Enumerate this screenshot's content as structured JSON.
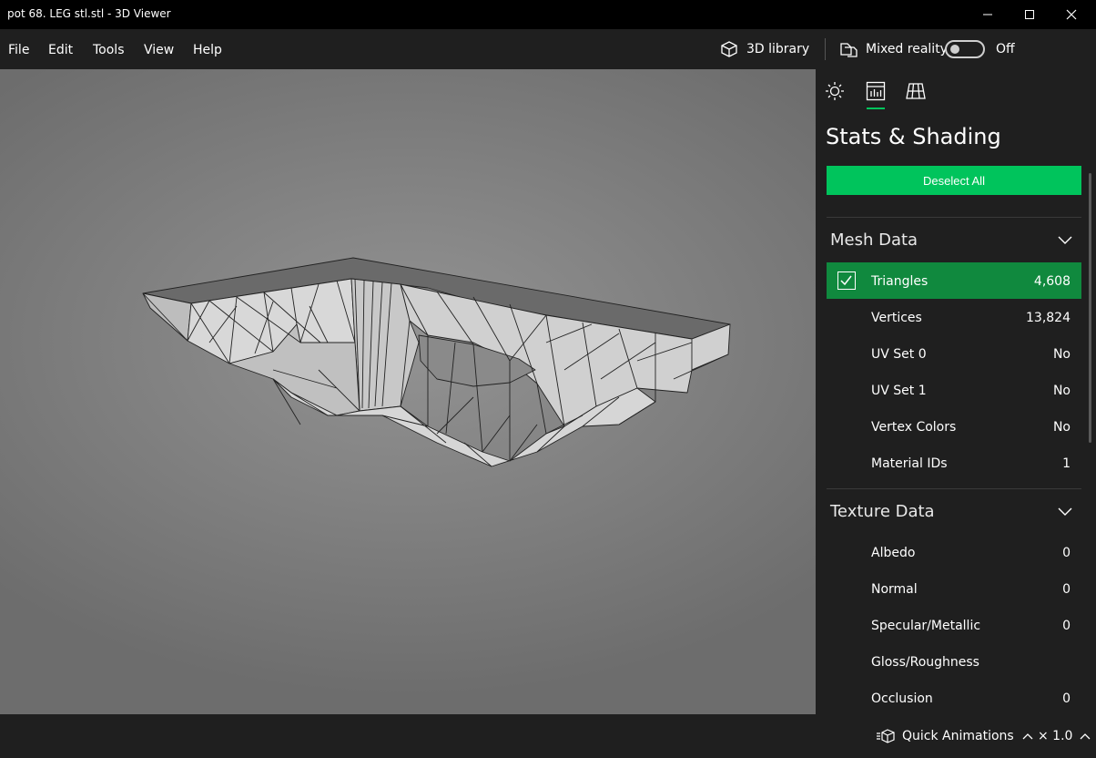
{
  "window": {
    "title": "pot 68. LEG stl.stl - 3D Viewer"
  },
  "menu": {
    "items": [
      "File",
      "Edit",
      "Tools",
      "View",
      "Help"
    ],
    "library_label": "3D library",
    "mixed_reality_label": "Mixed reality",
    "toggle_state": "Off"
  },
  "panel": {
    "title": "Stats & Shading",
    "deselect_label": "Deselect All",
    "mesh_section": {
      "title": "Mesh Data",
      "rows": [
        {
          "label": "Triangles",
          "value": "4,608",
          "selected": true
        },
        {
          "label": "Vertices",
          "value": "13,824"
        },
        {
          "label": "UV Set 0",
          "value": "No"
        },
        {
          "label": "UV Set 1",
          "value": "No"
        },
        {
          "label": "Vertex Colors",
          "value": "No"
        },
        {
          "label": "Material IDs",
          "value": "1"
        }
      ]
    },
    "texture_section": {
      "title": "Texture Data",
      "rows": [
        {
          "label": "Albedo",
          "value": "0"
        },
        {
          "label": "Normal",
          "value": "0"
        },
        {
          "label": "Specular/Metallic",
          "value": "0"
        },
        {
          "label": "Gloss/Roughness",
          "value": ""
        },
        {
          "label": "Occlusion",
          "value": "0"
        }
      ]
    }
  },
  "bottom": {
    "quick_animations_label": "Quick Animations",
    "speed_label": "× 1.0"
  },
  "colors": {
    "accent": "#00c45c",
    "selected_row": "#10893e"
  }
}
